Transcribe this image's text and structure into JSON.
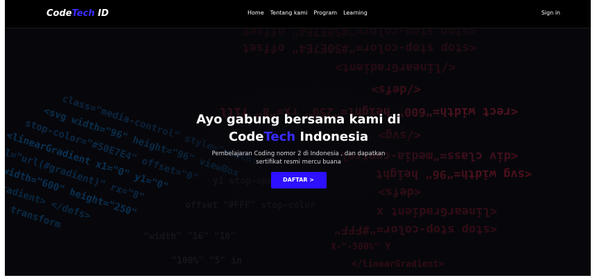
{
  "navbar": {
    "logo": {
      "part1": "Code",
      "part2": "Tech",
      "part3": " ID"
    },
    "links": [
      "Home",
      "Tentang kami",
      "Program",
      "Learning"
    ],
    "signin": "Sign in"
  },
  "hero": {
    "headline_line1": "Ayo gabung bersama kami di",
    "headline_code": "Code",
    "headline_tech": "Tech",
    "headline_rest": " Indonesia",
    "subtext_line1": "Pembelajaran Coding nomor 2 di Indonesia , dan dapatkan",
    "subtext_line2": "sertifikat resmi mercu buana",
    "cta_label": "DAFTAR >"
  },
  "colors": {
    "accent": "#3a2bff",
    "button": "#2d10ff",
    "background": "#07070b",
    "navbar": "#000000"
  }
}
